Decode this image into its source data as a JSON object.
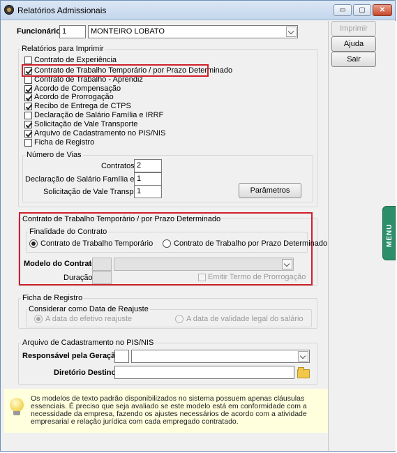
{
  "window": {
    "title": "Relatórios Admissionais",
    "min_glyph": "▭",
    "max_glyph": "▢",
    "close_glyph": "✕"
  },
  "funcionario": {
    "label": "Funcionário",
    "code": "1",
    "name": "MONTEIRO LOBATO"
  },
  "relatorios": {
    "title": "Relatórios para Imprimir",
    "items": [
      {
        "label": "Contrato de Experiência",
        "checked": false
      },
      {
        "label": "Contrato de Trabalho Temporário / por Prazo Determinado",
        "checked": true
      },
      {
        "label": "Contrato de Trabalho - Aprendiz",
        "checked": false
      },
      {
        "label": "Acordo de Compensação",
        "checked": true
      },
      {
        "label": "Acordo de Prorrogação",
        "checked": true
      },
      {
        "label": "Recibo de Entrega de CTPS",
        "checked": true
      },
      {
        "label": "Declaração de Salário Família e IRRF",
        "checked": false
      },
      {
        "label": "Solicitação de Vale Transporte",
        "checked": true
      },
      {
        "label": "Arquivo de Cadastramento no PIS/NIS",
        "checked": true
      },
      {
        "label": "Ficha de Registro",
        "checked": false
      }
    ]
  },
  "vias": {
    "title": "Número de Vias",
    "contratos_label": "Contratos",
    "contratos_value": "2",
    "declaracao_label": "Declaração de Salário Família e IRRF",
    "declaracao_value": "1",
    "solicitacao_label": "Solicitação de Vale Transporte",
    "solicitacao_value": "1",
    "parametros_button": "Parâmetros"
  },
  "contrato_temp": {
    "title": "Contrato de Trabalho Temporário / por Prazo Determinado",
    "finalidade_title": "Finalidade do Contrato",
    "option_temporario": "Contrato de Trabalho Temporário",
    "option_prazo": "Contrato de Trabalho por Prazo Determinado",
    "selected": "temporario",
    "modelo_label": "Modelo do Contrato",
    "modelo_code": "",
    "modelo_value": "",
    "duracao_label": "Duração",
    "duracao_value": "",
    "emitir_label": "Emitir Termo de Prorrogação"
  },
  "ficha": {
    "title": "Ficha de Registro",
    "reajuste_title": "Considerar como Data de Reajuste",
    "option_efetivo": "A data do efetivo reajuste",
    "option_validade": "A data de validade legal do salário"
  },
  "pis": {
    "title": "Arquivo de Cadastramento no PIS/NIS",
    "responsavel_label": "Responsável pela Geração",
    "responsavel_code": "",
    "responsavel_value": "",
    "diretorio_label": "Diretório Destino",
    "diretorio_value": ""
  },
  "info": {
    "text": "Os modelos de texto padrão disponibilizados no sistema possuem apenas cláusulas essenciais. É preciso que seja avaliado se este modelo está em conformidade com a necessidade da empresa, fazendo os ajustes necessários de acordo com a atividade empresarial e relação jurídica com cada empregado contratado."
  },
  "side": {
    "imprimir": "Imprimir",
    "ajuda": "Ajuda",
    "sair": "Sair",
    "menu_tab": "MENU"
  },
  "colors": {
    "highlight_red": "#d1202a",
    "menu_green": "#2d8f6a",
    "info_bg": "#ffffde"
  }
}
